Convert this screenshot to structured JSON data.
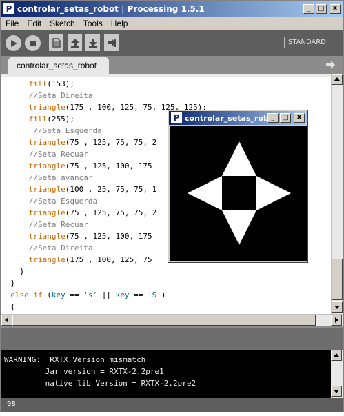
{
  "main_window": {
    "title": "controlar_setas_robot | Processing 1.5.1",
    "app_icon_letter": "P",
    "controls": {
      "minimize": "_",
      "maximize": "□",
      "close": "X"
    }
  },
  "menu": [
    "File",
    "Edit",
    "Sketch",
    "Tools",
    "Help"
  ],
  "toolbar": {
    "buttons": [
      "run-icon",
      "stop-icon",
      "new-icon",
      "open-icon",
      "save-icon",
      "export-icon"
    ],
    "mode": "STANDARD"
  },
  "tabs": [
    {
      "label": "controlar_setas_robot"
    }
  ],
  "editor": {
    "lines": [
      [
        {
          "t": "      "
        },
        {
          "t": "fill",
          "c": "fn"
        },
        {
          "t": "(153);"
        }
      ],
      [
        {
          "t": "      "
        },
        {
          "t": "//Seta Direita",
          "c": "cm"
        }
      ],
      [
        {
          "t": "      "
        },
        {
          "t": "triangle",
          "c": "fn"
        },
        {
          "t": "(175 , 100, 125, 75, 125, 125);"
        }
      ],
      [
        {
          "t": "      "
        },
        {
          "t": "fill",
          "c": "fn"
        },
        {
          "t": "(255);"
        }
      ],
      [
        {
          "t": "       "
        },
        {
          "t": "//Seta Esquerda",
          "c": "cm"
        }
      ],
      [
        {
          "t": "      "
        },
        {
          "t": "triangle",
          "c": "fn"
        },
        {
          "t": "(75 , 125, 75, 75, 2"
        }
      ],
      [
        {
          "t": "      "
        },
        {
          "t": "//Seta Recuar",
          "c": "cm"
        }
      ],
      [
        {
          "t": "      "
        },
        {
          "t": "triangle",
          "c": "fn"
        },
        {
          "t": "(75 , 125, 100, 175"
        }
      ],
      [
        {
          "t": "      "
        },
        {
          "t": "//Seta avançar",
          "c": "cm"
        }
      ],
      [
        {
          "t": "      "
        },
        {
          "t": "triangle",
          "c": "fn"
        },
        {
          "t": "(100 , 25, 75, 75, 1"
        }
      ],
      [
        {
          "t": "      "
        },
        {
          "t": "//Seta Esquerda",
          "c": "cm"
        }
      ],
      [
        {
          "t": "      "
        },
        {
          "t": "triangle",
          "c": "fn"
        },
        {
          "t": "(75 , 125, 75, 75, 2"
        }
      ],
      [
        {
          "t": "      "
        },
        {
          "t": "//Seta Recuar",
          "c": "cm"
        }
      ],
      [
        {
          "t": "      "
        },
        {
          "t": "triangle",
          "c": "fn"
        },
        {
          "t": "(75 , 125, 100, 175"
        }
      ],
      [
        {
          "t": "      "
        },
        {
          "t": "//Seta Direita",
          "c": "cm"
        }
      ],
      [
        {
          "t": "      "
        },
        {
          "t": "triangle",
          "c": "fn"
        },
        {
          "t": "(175 , 100, 125, 75"
        }
      ],
      [
        {
          "t": "    }"
        }
      ],
      [
        {
          "t": "  }"
        }
      ],
      [
        {
          "t": "  "
        },
        {
          "t": "else if",
          "c": "ctl"
        },
        {
          "t": " ("
        },
        {
          "t": "key",
          "c": "var"
        },
        {
          "t": " == "
        },
        {
          "t": "'s'",
          "c": "str"
        },
        {
          "t": " || "
        },
        {
          "t": "key",
          "c": "var"
        },
        {
          "t": " == "
        },
        {
          "t": "'S'",
          "c": "str"
        },
        {
          "t": ")"
        }
      ],
      [
        {
          "t": "  {"
        }
      ]
    ]
  },
  "console": {
    "lines": [
      "WARNING:  RXTX Version mismatch",
      "         Jar version = RXTX-2.2pre1",
      "         native lib Version = RXTX-2.2pre2"
    ]
  },
  "status": {
    "line_number": "98"
  },
  "sketch_window": {
    "title": "controlar_setas_rob...",
    "app_icon_letter": "P",
    "controls": {
      "minimize": "_",
      "maximize": "□",
      "close": "X"
    }
  },
  "colors": {
    "title_gradient_start": "#0a246a",
    "title_gradient_end": "#a6caf0",
    "toolbar": "#5e5e5e",
    "function_keyword": "#cc6600",
    "comment": "#7e7e7e",
    "console_bg": "#000000",
    "canvas_bg": "#000000",
    "shape_fill": "#ffffff"
  }
}
